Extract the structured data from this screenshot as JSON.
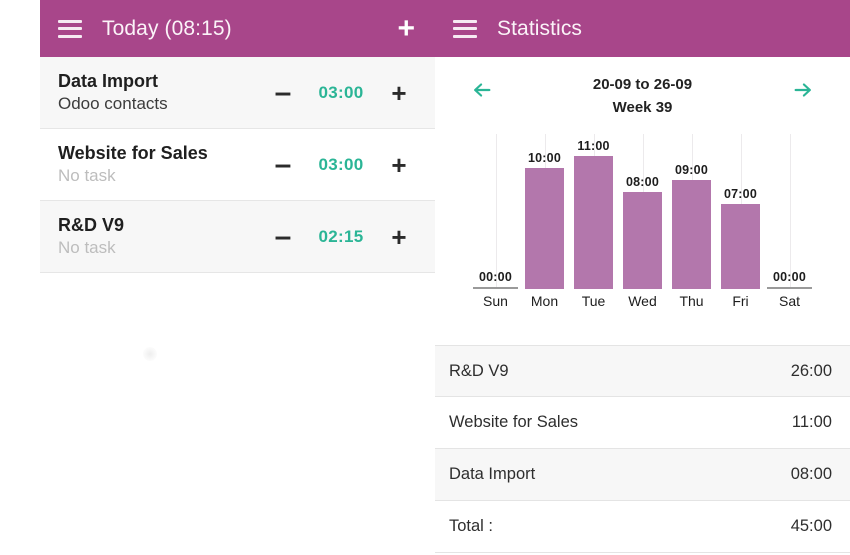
{
  "colors": {
    "appbar": "#a8468a",
    "accent_teal": "#2bb596",
    "bar_fill": "#b377ac",
    "row_shaded": "#f7f7f7"
  },
  "left": {
    "appbar": {
      "menu_icon": "hamburger-menu-icon",
      "title": "Today (08:15)",
      "add_label": "+"
    },
    "tasks": [
      {
        "name": "Data Import",
        "subtitle": "Odoo contacts",
        "subtitle_muted": false,
        "time": "03:00",
        "minus_label": "–",
        "plus_label": "+"
      },
      {
        "name": "Website for Sales",
        "subtitle": "No task",
        "subtitle_muted": true,
        "time": "03:00",
        "minus_label": "–",
        "plus_label": "+"
      },
      {
        "name": "R&D V9",
        "subtitle": "No task",
        "subtitle_muted": true,
        "time": "02:15",
        "minus_label": "–",
        "plus_label": "+"
      }
    ]
  },
  "right": {
    "appbar": {
      "menu_icon": "hamburger-menu-icon",
      "title": "Statistics"
    },
    "week_nav": {
      "prev_icon": "arrow-left-icon",
      "next_icon": "arrow-right-icon",
      "range": "20-09 to 26-09",
      "week": "Week 39"
    },
    "summary": {
      "rows": [
        {
          "label": "R&D V9",
          "value": "26:00"
        },
        {
          "label": "Website for Sales",
          "value": "11:00"
        },
        {
          "label": "Data Import",
          "value": "08:00"
        }
      ],
      "total_label": "Total :",
      "total_value": "45:00"
    }
  },
  "chart_data": {
    "type": "bar",
    "title": "20-09 to 26-09 Week 39",
    "xlabel": "",
    "ylabel": "",
    "categories": [
      "Sun",
      "Mon",
      "Tue",
      "Wed",
      "Thu",
      "Fri",
      "Sat"
    ],
    "values": [
      0,
      10,
      11,
      8,
      9,
      7,
      0
    ],
    "labels": [
      "00:00",
      "10:00",
      "11:00",
      "08:00",
      "09:00",
      "07:00",
      "00:00"
    ],
    "ylim": [
      0,
      11
    ],
    "grid": true,
    "legend": false,
    "bar_color": "#b377ac"
  }
}
